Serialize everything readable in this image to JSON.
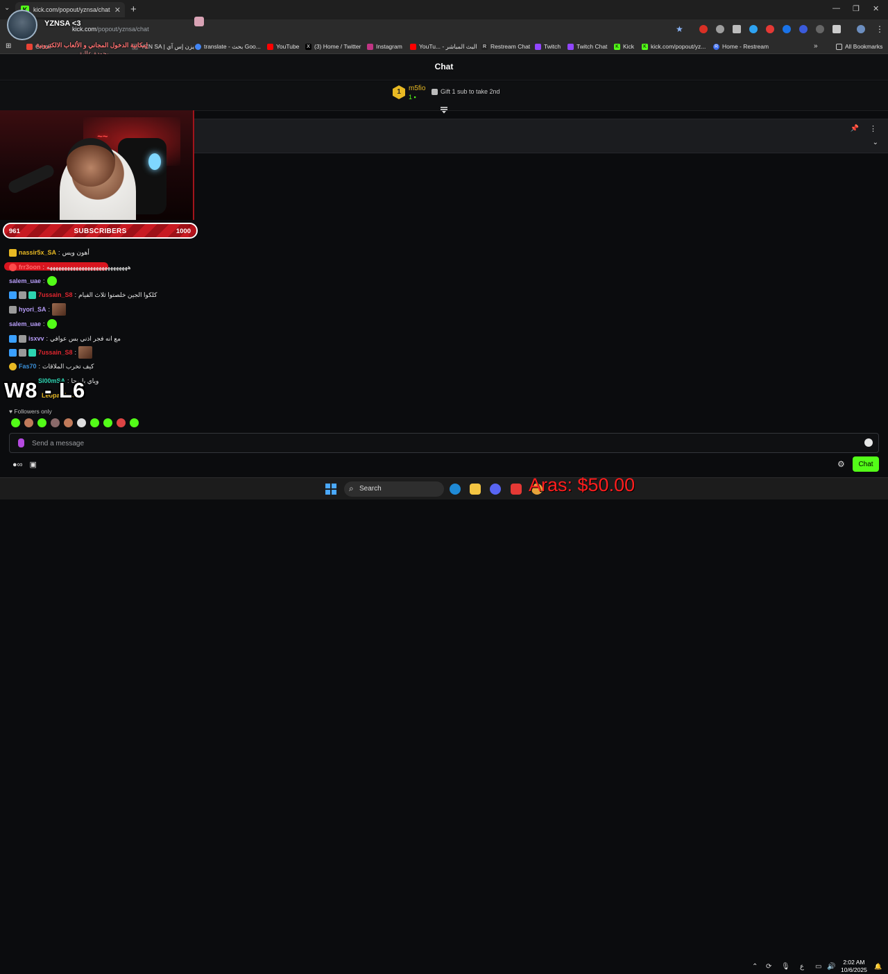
{
  "browser": {
    "tab_title": "kick.com/popout/yznsa/chat",
    "url_domain": "kick.com",
    "url_path": "/popout/yznsa/chat",
    "bookmarks": [
      {
        "label": "Gmail",
        "color": "#ea4335"
      },
      {
        "label": "YZN SA | يزن إس آي",
        "color": "#555555"
      },
      {
        "label": "translate - بحث Goo...",
        "color": "#4285f4"
      },
      {
        "label": "YouTube",
        "color": "#ff0000"
      },
      {
        "label": "(3) Home / Twitter",
        "color": "#000000"
      },
      {
        "label": "Instagram",
        "color": "#c13584"
      },
      {
        "label": "YouTu... - البث المباشر",
        "color": "#ff0000"
      },
      {
        "label": "Restream Chat",
        "color": "#222222"
      },
      {
        "label": "Twitch",
        "color": "#9146ff"
      },
      {
        "label": "Twitch Chat",
        "color": "#9146ff"
      },
      {
        "label": "Kick",
        "color": "#53fc18"
      },
      {
        "label": "kick.com/popout/yz...",
        "color": "#53fc18"
      },
      {
        "label": "Home - Restream",
        "color": "#3c6cf0"
      }
    ],
    "all_bookmarks_label": "All Bookmarks"
  },
  "overlay": {
    "streamer_name": "YZNSA <3",
    "arabic_line1": "إمكانية الدخول المجاني و الألعاب الالكترونية",
    "arabic_line2": "بجودة عالية",
    "wl_score": "W8 - L6",
    "donation_text": "Aras: $50.00"
  },
  "chat": {
    "title": "Chat",
    "leaderboard": {
      "rank": "1",
      "user": "m5fio",
      "count": "1",
      "gift_text": "Gift 1 sub to take 2nd"
    },
    "subscribers": {
      "current": "961",
      "label": "SUBSCRIBERS",
      "goal": "1000",
      "progress": 0.961
    },
    "messages": [
      {
        "user": "nassir5x_SA",
        "color": "#e8b923",
        "text": "أهون ويس",
        "badges": [
          "#e8b923"
        ]
      },
      {
        "user": "frr3oon",
        "color": "#ff6b6b",
        "text": "ههههههههههههههههههههههههههههه",
        "badges": [
          "#ff4a4a"
        ]
      },
      {
        "user": "salem_uae",
        "color": "#b69cf7",
        "text": "",
        "badges": [],
        "emotes": [
          "#53fc18"
        ]
      },
      {
        "user": "7ussain_S8",
        "color": "#e0262f",
        "text": "كلكوا الجين خلصتوا ثلاث الفيام",
        "badges": [
          "#3aa0ff",
          "#9a9a9a",
          "#2dd4b1"
        ]
      },
      {
        "user": "hyori_SA",
        "color": "#b69cf7",
        "text": "",
        "badges": [
          "#9a9a9a"
        ],
        "emote_square": true
      },
      {
        "user": "salem_uae",
        "color": "#b69cf7",
        "text": "",
        "badges": [],
        "emotes": [
          "#53fc18"
        ]
      },
      {
        "user": "isxvv",
        "color": "#b69cf7",
        "text": "مع انه فجر اذني بس عوافي",
        "badges": [
          "#3aa0ff",
          "#9a9a9a"
        ]
      },
      {
        "user": "7ussain_S8",
        "color": "#e0262f",
        "text": "",
        "badges": [
          "#3aa0ff",
          "#9a9a9a",
          "#2dd4b1"
        ],
        "emote_square": true
      },
      {
        "user": "Fas70",
        "color": "#3a8fd8",
        "text": "كيف تخرب الملاقات",
        "badges": [
          "#e8b923"
        ]
      },
      {
        "user": "Sl00mSA",
        "color": "#2dd4b1",
        "text": "وياي ياربحا",
        "badges": [
          "#3aa0ff"
        ]
      },
      {
        "user": "Leopardos",
        "color": "#e8b923",
        "text": "",
        "badges": [
          "#3aa0ff"
        ]
      }
    ],
    "followers_only": "Followers only",
    "emote_colors": [
      "#53fc18",
      "#c07a5a",
      "#53fc18",
      "#8a6a6a",
      "#c07a5a",
      "#ddd",
      "#53fc18",
      "#53fc18",
      "#d44",
      "#53fc18"
    ],
    "input_placeholder": "Send a message",
    "send_label": "Chat"
  },
  "taskbar": {
    "search_label": "Search",
    "time": "2:02 AM",
    "date": "10/6/2025",
    "lang": "ع"
  }
}
